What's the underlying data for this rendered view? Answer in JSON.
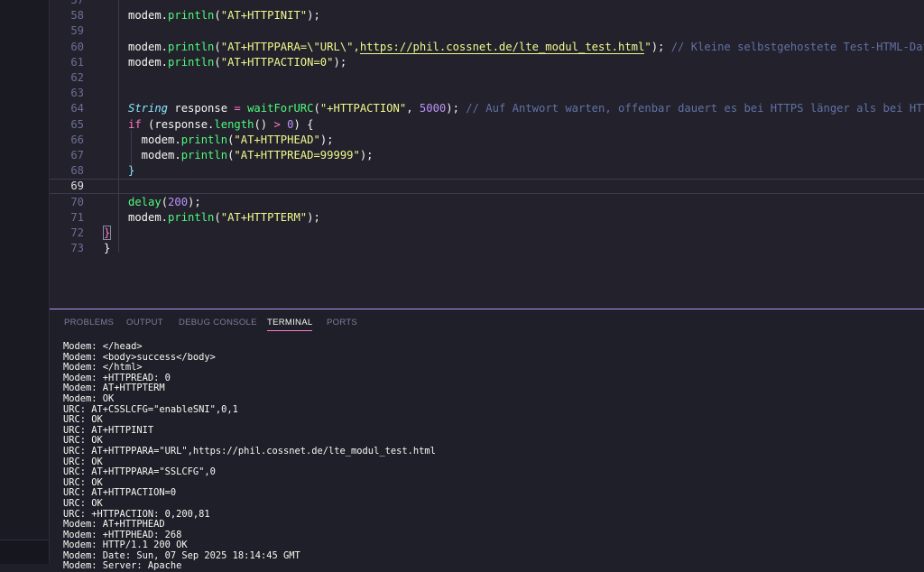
{
  "editor": {
    "lines": [
      {
        "num": "57",
        "tokens": []
      },
      {
        "num": "58",
        "tokens": [
          [
            "plain",
            "modem."
          ],
          [
            "fn",
            "println"
          ],
          [
            "plain",
            "("
          ],
          [
            "str",
            "\"AT+HTTPINIT\""
          ],
          [
            "plain",
            ");"
          ]
        ]
      },
      {
        "num": "59",
        "tokens": []
      },
      {
        "num": "60",
        "tokens": [
          [
            "plain",
            "modem."
          ],
          [
            "fn",
            "println"
          ],
          [
            "plain",
            "("
          ],
          [
            "str",
            "\"AT+HTTPPARA=\\\"URL\\\","
          ],
          [
            "url",
            "https://phil.cossnet.de/lte_modul_test.html"
          ],
          [
            "str",
            "\""
          ],
          [
            "plain",
            "); "
          ],
          [
            "cmt",
            "// Kleine selbstgehostete Test-HTML-Datei"
          ]
        ]
      },
      {
        "num": "61",
        "tokens": [
          [
            "plain",
            "modem."
          ],
          [
            "fn",
            "println"
          ],
          [
            "plain",
            "("
          ],
          [
            "str",
            "\"AT+HTTPACTION=0\""
          ],
          [
            "plain",
            ");"
          ]
        ]
      },
      {
        "num": "62",
        "tokens": []
      },
      {
        "num": "63",
        "tokens": []
      },
      {
        "num": "64",
        "tokens": [
          [
            "type",
            "String"
          ],
          [
            "plain",
            " response "
          ],
          [
            "kw",
            "="
          ],
          [
            "plain",
            " "
          ],
          [
            "fn",
            "waitForURC"
          ],
          [
            "plain",
            "("
          ],
          [
            "str",
            "\"+HTTPACTION\""
          ],
          [
            "plain",
            ", "
          ],
          [
            "num",
            "5000"
          ],
          [
            "plain",
            "); "
          ],
          [
            "cmt",
            "// Auf Antwort warten, offenbar dauert es bei HTTPS länger als bei HTTP"
          ]
        ]
      },
      {
        "num": "65",
        "tokens": [
          [
            "kw",
            "if"
          ],
          [
            "plain",
            " (response."
          ],
          [
            "fn",
            "length"
          ],
          [
            "plain",
            "() "
          ],
          [
            "kw",
            ">"
          ],
          [
            "plain",
            " "
          ],
          [
            "num",
            "0"
          ],
          [
            "plain",
            ") {"
          ]
        ]
      },
      {
        "num": "66",
        "tokens": [
          [
            "plain",
            "  modem."
          ],
          [
            "fn",
            "println"
          ],
          [
            "plain",
            "("
          ],
          [
            "str",
            "\"AT+HTTPHEAD\""
          ],
          [
            "plain",
            ");"
          ]
        ]
      },
      {
        "num": "67",
        "tokens": [
          [
            "plain",
            "  modem."
          ],
          [
            "fn",
            "println"
          ],
          [
            "plain",
            "("
          ],
          [
            "str",
            "\"AT+HTTPREAD=99999\""
          ],
          [
            "plain",
            ");"
          ]
        ]
      },
      {
        "num": "68",
        "tokens": [
          [
            "brace",
            "}"
          ]
        ]
      },
      {
        "num": "69",
        "tokens": []
      },
      {
        "num": "70",
        "tokens": [
          [
            "fn",
            "delay"
          ],
          [
            "plain",
            "("
          ],
          [
            "num",
            "200"
          ],
          [
            "plain",
            ");"
          ]
        ]
      },
      {
        "num": "71",
        "tokens": [
          [
            "plain",
            "modem."
          ],
          [
            "fn",
            "println"
          ],
          [
            "plain",
            "("
          ],
          [
            "str",
            "\"AT+HTTPTERM\""
          ],
          [
            "plain",
            ");"
          ]
        ]
      },
      {
        "num": "72",
        "tokens": [
          [
            "kw",
            "}"
          ]
        ]
      },
      {
        "num": "73",
        "tokens": [
          [
            "plain",
            "}"
          ]
        ]
      }
    ]
  },
  "panel": {
    "tabs": [
      {
        "label": "PROBLEMS",
        "active": false
      },
      {
        "label": "OUTPUT",
        "active": false
      },
      {
        "label": "DEBUG CONSOLE",
        "active": false
      },
      {
        "label": "TERMINAL",
        "active": true
      },
      {
        "label": "PORTS",
        "active": false
      }
    ],
    "terminal_lines": [
      "Modem: </head>",
      "Modem: <body>success</body>",
      "Modem: </html>",
      "Modem: +HTTPREAD: 0",
      "Modem: AT+HTTPTERM",
      "Modem: OK",
      "URC: AT+CSSLCFG=\"enableSNI\",0,1",
      "URC: OK",
      "URC: AT+HTTPINIT",
      "URC: OK",
      "URC: AT+HTTPPARA=\"URL\",https://phil.cossnet.de/lte_modul_test.html",
      "URC: OK",
      "URC: AT+HTTPPARA=\"SSLCFG\",0",
      "URC: OK",
      "URC: AT+HTTPACTION=0",
      "URC: OK",
      "URC: +HTTPACTION: 0,200,81",
      "Modem: AT+HTTPHEAD",
      "Modem: +HTTPHEAD: 268",
      "Modem: HTTP/1.1 200 OK",
      "Modem: Date: Sun, 07 Sep 2025 18:14:45 GMT",
      "Modem: Server: Apache"
    ]
  },
  "colors": {
    "accent": "#bd93f9",
    "active_tab_underline": "#ff79c6",
    "string": "#f1fa8c",
    "function": "#50fa7b",
    "keyword": "#ff79c6",
    "comment": "#6272a4"
  }
}
